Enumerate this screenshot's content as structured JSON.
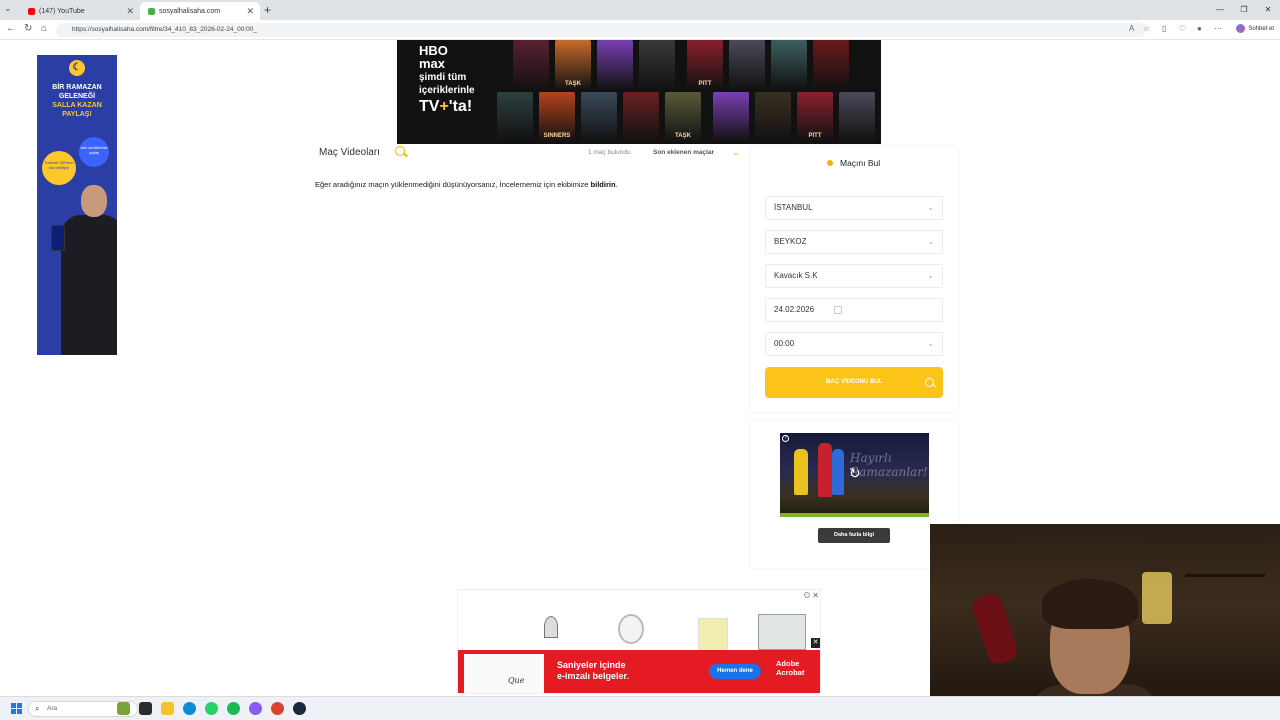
{
  "browser": {
    "tabs": [
      {
        "label": "(147) YouTube",
        "active": false,
        "favicon_color": "#ff0000"
      },
      {
        "label": "sosyalhalisaha.com",
        "active": true,
        "favicon_color": "#44b24a"
      }
    ],
    "new_tab": "+",
    "tab_menu": "⌄",
    "url": "https://sosyalhalisaha.com/filtre/34_410_83_2026-02-24_00:00_",
    "chat_label": "Sohbet et",
    "window_controls": [
      "—",
      "❐",
      "✕"
    ]
  },
  "left_ad": {
    "headline_line1": "BİR RAMAZAN",
    "headline_line2": "GELENEĞİ",
    "headline_line3": "SALLA KAZAN",
    "headline_line4": "PAYLAŞ!",
    "badge_text": "Turkcell Gift'lerin sizi bekliyor",
    "badge2_text": "İster sevdiklerinle paylaş"
  },
  "top_ad": {
    "brand_line1": "HBO",
    "brand_line2": "max",
    "promo": "şimdi tüm içeriklerinle",
    "tv": "TV",
    "tv_suffix": "'ta!",
    "posters": [
      {
        "title": "",
        "color": "#5a2030"
      },
      {
        "title": "TAŞK",
        "color": "#c96b2a"
      },
      {
        "title": "",
        "color": "#7a3fb3"
      },
      {
        "title": "",
        "color": "#3a3a3a"
      },
      {
        "title": "PITT",
        "color": "#8a1f2a"
      },
      {
        "title": "",
        "color": "#4a4a5a"
      },
      {
        "title": "",
        "color": "#3e5e5e"
      },
      {
        "title": "",
        "color": "#6a1a1a"
      },
      {
        "title": "",
        "color": "#2f3f3f"
      },
      {
        "title": "SINNERS",
        "color": "#b5441c"
      },
      {
        "title": "",
        "color": "#3a4a5a"
      },
      {
        "title": "",
        "color": "#6a2020"
      },
      {
        "title": "TAŞK",
        "color": "#5a5a3a"
      },
      {
        "title": "",
        "color": "#7a3fb3"
      },
      {
        "title": "",
        "color": "#3a3020"
      },
      {
        "title": "PITT",
        "color": "#8a2030"
      },
      {
        "title": "",
        "color": "#4a4a5a"
      }
    ]
  },
  "main": {
    "title": "Maç Videoları",
    "match_count": "1 maç bulundu",
    "sort_label": "Son eklenen maçlar",
    "sort_chevron": "⌄",
    "notice_text": "Eğer aradığınız maçın yüklenmediğini düşünüyorsanız, İncelememiz için ekibimize",
    "notice_link": "bildirin",
    "notice_end": "."
  },
  "finder": {
    "title": "Maçını Bul",
    "city": "İSTANBUL",
    "district": "BEYKOZ",
    "venue": "Kavacık S.K",
    "date": "24.02.2026",
    "time": "00:00",
    "chevron": "⌄",
    "submit_label": "MAÇ VİDEONU BUL",
    "accent_color": "#fcc419"
  },
  "sidebar_ad": {
    "video_overlay_text": "Hayırlı Ramazanlar!",
    "more_info": "Daha fazla bilgi",
    "info": "?",
    "replay_icon": "↻"
  },
  "bottom_ad": {
    "message_line1": "Saniyeler içinde",
    "message_line2": "e-imzalı belgeler.",
    "cta": "Hemen dene",
    "brand_line1": "Adobe",
    "brand_line2": "Acrobat",
    "close": "✕",
    "info": "i",
    "signature": "Que"
  },
  "taskbar": {
    "search_placeholder": "Ara",
    "icons": [
      {
        "name": "widgets-icon",
        "color": "#7aa33c"
      },
      {
        "name": "task-view-icon",
        "color": "#2c2c2c"
      },
      {
        "name": "file-explorer-icon",
        "color": "#f5c12e"
      },
      {
        "name": "edge-icon",
        "color": "#0e8ad6"
      },
      {
        "name": "whatsapp-icon",
        "color": "#25d366"
      },
      {
        "name": "spotify-icon",
        "color": "#1db954"
      },
      {
        "name": "app-icon",
        "color": "#8a5cf6"
      },
      {
        "name": "game-icon",
        "color": "#d9442d"
      },
      {
        "name": "steam-icon",
        "color": "#1b2838"
      }
    ]
  }
}
